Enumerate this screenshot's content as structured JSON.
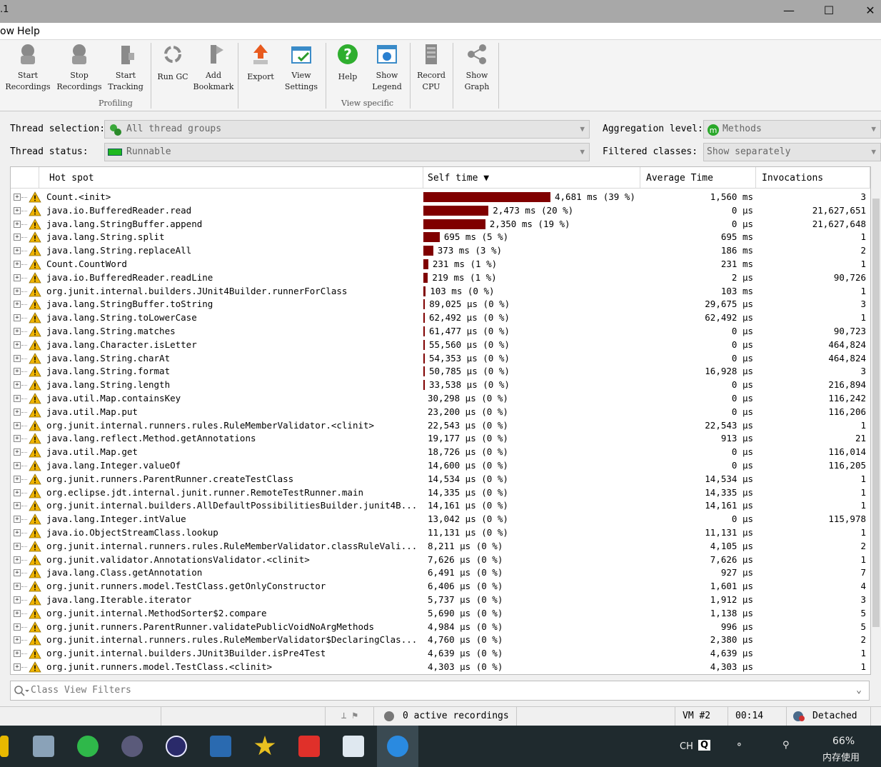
{
  "window": {
    "title_fragment": ".1",
    "min_icon": "minimize-icon",
    "max_icon": "maximize-icon",
    "close_icon": "close-icon"
  },
  "menu": {
    "items": [
      "ow",
      "Help"
    ]
  },
  "toolbar": {
    "buttons": [
      {
        "line1": "Start",
        "line2": "Recordings",
        "icon": "start-recordings-icon"
      },
      {
        "line1": "Stop",
        "line2": "Recordings",
        "icon": "stop-recordings-icon"
      },
      {
        "line1": "Start",
        "line2": "Tracking",
        "icon": "start-tracking-icon"
      },
      {
        "line1": "Run GC",
        "line2": "",
        "icon": "recycle-icon"
      },
      {
        "line1": "Add",
        "line2": "Bookmark",
        "icon": "bookmark-icon"
      },
      {
        "line1": "Export",
        "line2": "",
        "icon": "export-icon"
      },
      {
        "line1": "View",
        "line2": "Settings",
        "icon": "settings-icon"
      },
      {
        "line1": "Help",
        "line2": "",
        "icon": "help-icon"
      },
      {
        "line1": "Show",
        "line2": "Legend",
        "icon": "legend-icon"
      },
      {
        "line1": "Record",
        "line2": "CPU",
        "icon": "cpu-icon"
      },
      {
        "line1": "Show",
        "line2": "Graph",
        "icon": "graph-icon"
      }
    ],
    "group_profiling": "Profiling",
    "group_view_specific": "View specific"
  },
  "filters": {
    "thread_selection_label": "Thread selection:",
    "thread_selection_value": "All thread groups",
    "thread_status_label": "Thread status:",
    "thread_status_value": "Runnable",
    "aggregation_label": "Aggregation level:",
    "aggregation_value": "Methods",
    "filtered_classes_label": "Filtered classes:",
    "filtered_classes_value": "Show separately"
  },
  "table": {
    "headers": {
      "hotspot": "Hot spot",
      "self_time": "Self time ▼",
      "avg_time": "Average Time",
      "invocations": "Invocations"
    },
    "rows": [
      {
        "name": "Count.<init>",
        "self": "4,681 ms (39 %)",
        "pct": 39,
        "avg": "1,560 ms",
        "inv": "3"
      },
      {
        "name": "java.io.BufferedReader.read",
        "self": "2,473 ms (20 %)",
        "pct": 20,
        "avg": "0 µs",
        "inv": "21,627,651"
      },
      {
        "name": "java.lang.StringBuffer.append",
        "self": "2,350 ms (19 %)",
        "pct": 19,
        "avg": "0 µs",
        "inv": "21,627,648"
      },
      {
        "name": "java.lang.String.split",
        "self": "695 ms (5 %)",
        "pct": 5,
        "avg": "695 ms",
        "inv": "1"
      },
      {
        "name": "java.lang.String.replaceAll",
        "self": "373 ms (3 %)",
        "pct": 3,
        "avg": "186 ms",
        "inv": "2"
      },
      {
        "name": "Count.CountWord",
        "self": "231 ms (1 %)",
        "pct": 1.5,
        "avg": "231 ms",
        "inv": "1"
      },
      {
        "name": "java.io.BufferedReader.readLine",
        "self": "219 ms (1 %)",
        "pct": 1.4,
        "avg": "2 µs",
        "inv": "90,726"
      },
      {
        "name": "org.junit.internal.builders.JUnit4Builder.runnerForClass",
        "self": "103 ms (0 %)",
        "pct": 0.7,
        "avg": "103 ms",
        "inv": "1"
      },
      {
        "name": "java.lang.StringBuffer.toString",
        "self": "89,025 µs (0 %)",
        "pct": 0.5,
        "avg": "29,675 µs",
        "inv": "3"
      },
      {
        "name": "java.lang.String.toLowerCase",
        "self": "62,492 µs (0 %)",
        "pct": 0.4,
        "avg": "62,492 µs",
        "inv": "1"
      },
      {
        "name": "java.lang.String.matches",
        "self": "61,477 µs (0 %)",
        "pct": 0.4,
        "avg": "0 µs",
        "inv": "90,723"
      },
      {
        "name": "java.lang.Character.isLetter",
        "self": "55,560 µs (0 %)",
        "pct": 0.35,
        "avg": "0 µs",
        "inv": "464,824"
      },
      {
        "name": "java.lang.String.charAt",
        "self": "54,353 µs (0 %)",
        "pct": 0.35,
        "avg": "0 µs",
        "inv": "464,824"
      },
      {
        "name": "java.lang.String.format",
        "self": "50,785 µs (0 %)",
        "pct": 0.3,
        "avg": "16,928 µs",
        "inv": "3"
      },
      {
        "name": "java.lang.String.length",
        "self": "33,538 µs (0 %)",
        "pct": 0.25,
        "avg": "0 µs",
        "inv": "216,894"
      },
      {
        "name": "java.util.Map.containsKey",
        "self": "30,298 µs (0 %)",
        "pct": 0,
        "avg": "0 µs",
        "inv": "116,242"
      },
      {
        "name": "java.util.Map.put",
        "self": "23,200 µs (0 %)",
        "pct": 0,
        "avg": "0 µs",
        "inv": "116,206"
      },
      {
        "name": "org.junit.internal.runners.rules.RuleMemberValidator.<clinit>",
        "self": "22,543 µs (0 %)",
        "pct": 0,
        "avg": "22,543 µs",
        "inv": "1"
      },
      {
        "name": "java.lang.reflect.Method.getAnnotations",
        "self": "19,177 µs (0 %)",
        "pct": 0,
        "avg": "913 µs",
        "inv": "21"
      },
      {
        "name": "java.util.Map.get",
        "self": "18,726 µs (0 %)",
        "pct": 0,
        "avg": "0 µs",
        "inv": "116,014"
      },
      {
        "name": "java.lang.Integer.valueOf",
        "self": "14,600 µs (0 %)",
        "pct": 0,
        "avg": "0 µs",
        "inv": "116,205"
      },
      {
        "name": "org.junit.runners.ParentRunner.createTestClass",
        "self": "14,534 µs (0 %)",
        "pct": 0,
        "avg": "14,534 µs",
        "inv": "1"
      },
      {
        "name": "org.eclipse.jdt.internal.junit.runner.RemoteTestRunner.main",
        "self": "14,335 µs (0 %)",
        "pct": 0,
        "avg": "14,335 µs",
        "inv": "1"
      },
      {
        "name": "org.junit.internal.builders.AllDefaultPossibilitiesBuilder.junit4B...",
        "self": "14,161 µs (0 %)",
        "pct": 0,
        "avg": "14,161 µs",
        "inv": "1"
      },
      {
        "name": "java.lang.Integer.intValue",
        "self": "13,042 µs (0 %)",
        "pct": 0,
        "avg": "0 µs",
        "inv": "115,978"
      },
      {
        "name": "java.io.ObjectStreamClass.lookup",
        "self": "11,131 µs (0 %)",
        "pct": 0,
        "avg": "11,131 µs",
        "inv": "1"
      },
      {
        "name": "org.junit.internal.runners.rules.RuleMemberValidator.classRuleVali...",
        "self": "8,211 µs (0 %)",
        "pct": 0,
        "avg": "4,105 µs",
        "inv": "2"
      },
      {
        "name": "org.junit.validator.AnnotationsValidator.<clinit>",
        "self": "7,626 µs (0 %)",
        "pct": 0,
        "avg": "7,626 µs",
        "inv": "1"
      },
      {
        "name": "java.lang.Class.getAnnotation",
        "self": "6,491 µs (0 %)",
        "pct": 0,
        "avg": "927 µs",
        "inv": "7"
      },
      {
        "name": "org.junit.runners.model.TestClass.getOnlyConstructor",
        "self": "6,406 µs (0 %)",
        "pct": 0,
        "avg": "1,601 µs",
        "inv": "4"
      },
      {
        "name": "java.lang.Iterable.iterator",
        "self": "5,737 µs (0 %)",
        "pct": 0,
        "avg": "1,912 µs",
        "inv": "3"
      },
      {
        "name": "org.junit.internal.MethodSorter$2.compare",
        "self": "5,690 µs (0 %)",
        "pct": 0,
        "avg": "1,138 µs",
        "inv": "5"
      },
      {
        "name": "org.junit.runners.ParentRunner.validatePublicVoidNoArgMethods",
        "self": "4,984 µs (0 %)",
        "pct": 0,
        "avg": "996 µs",
        "inv": "5"
      },
      {
        "name": "org.junit.internal.runners.rules.RuleMemberValidator$DeclaringClas...",
        "self": "4,760 µs (0 %)",
        "pct": 0,
        "avg": "2,380 µs",
        "inv": "2"
      },
      {
        "name": "org.junit.internal.builders.JUnit3Builder.isPre4Test",
        "self": "4,639 µs (0 %)",
        "pct": 0,
        "avg": "4,639 µs",
        "inv": "1"
      },
      {
        "name": "org.junit.runners.model.TestClass.<clinit>",
        "self": "4,303 µs (0 %)",
        "pct": 0,
        "avg": "4,303 µs",
        "inv": "1"
      }
    ]
  },
  "class_filter": {
    "placeholder": "Class View Filters"
  },
  "status": {
    "recordings": "0 active recordings",
    "vm": "VM #2",
    "time": "00:14",
    "mode": "Detached"
  },
  "taskbar": {
    "lang": "CH",
    "ime": "Q",
    "memory_pct": "66%",
    "memory_label": "内存使用"
  },
  "colors": {
    "bar": "#800000",
    "warn": "#f0b400",
    "titlebar": "#a8a8a8",
    "taskbar": "#1f2a2e"
  }
}
